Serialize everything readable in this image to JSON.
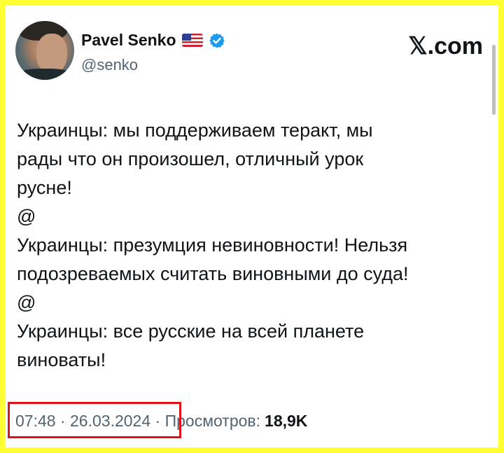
{
  "author": {
    "display_name": "Pavel Senko",
    "handle": "@senko"
  },
  "brand_text": "𝕏.com",
  "tweet_lines": [
    "Украинцы: мы поддерживаем теракт, мы",
    "рады что он произошел, отличный урок",
    "русне!",
    "@",
    "Украинцы: презумция невиновности! Нельзя",
    "подозреваемых считать виновными до суда!",
    "@",
    "Украинцы: все русские на всей планете",
    "виноваты!"
  ],
  "meta": {
    "time": "07:48",
    "separator1": " · ",
    "date": "26.03.2024",
    "separator2": " · ",
    "views_label": "Просмотров:",
    "views_count": "18,9K"
  },
  "colors": {
    "border": "#ffff33",
    "highlight": "#e0131b",
    "verified": "#1d9bf0",
    "muted": "#536471"
  }
}
